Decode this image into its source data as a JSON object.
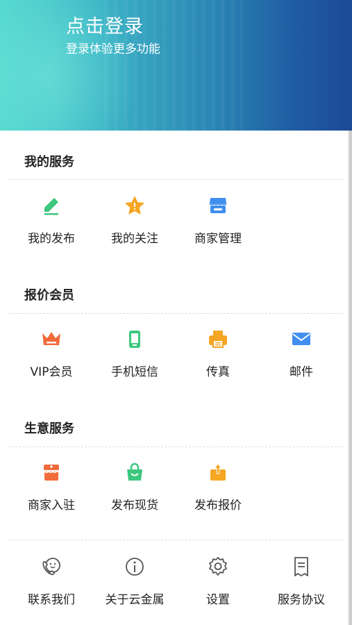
{
  "header": {
    "login_title": "点击登录",
    "login_subtitle": "登录体验更多功能",
    "gradient_start": "#54d8cf",
    "gradient_end": "#1c4a96"
  },
  "sections": {
    "my_services": {
      "title": "我的服务",
      "items": [
        {
          "label": "我的发布",
          "icon": "pencil-icon",
          "color": "#3dc77e"
        },
        {
          "label": "我的关注",
          "icon": "star-icon",
          "color": "#f5a623"
        },
        {
          "label": "商家管理",
          "icon": "store-icon",
          "color": "#3f8ef0"
        }
      ]
    },
    "quote_members": {
      "title": "报价会员",
      "items": [
        {
          "label": "VIP会员",
          "icon": "crown-icon",
          "color": "#f26b3a"
        },
        {
          "label": "手机短信",
          "icon": "phone-icon",
          "color": "#3dc77e"
        },
        {
          "label": "传真",
          "icon": "fax-icon",
          "color": "#f5a623"
        },
        {
          "label": "邮件",
          "icon": "mail-icon",
          "color": "#3f8ef0"
        }
      ]
    },
    "business_services": {
      "title": "生意服务",
      "items": [
        {
          "label": "商家入驻",
          "icon": "shop-entry-icon",
          "color": "#f26b3a"
        },
        {
          "label": "发布现货",
          "icon": "bag-icon",
          "color": "#3dc77e"
        },
        {
          "label": "发布报价",
          "icon": "upload-box-icon",
          "color": "#f5a623"
        }
      ]
    },
    "other": {
      "items": [
        {
          "label": "联系我们",
          "icon": "support-phone-icon",
          "color": "#555555"
        },
        {
          "label": "关于云金属",
          "icon": "info-icon",
          "color": "#555555"
        },
        {
          "label": "设置",
          "icon": "gear-icon",
          "color": "#555555"
        },
        {
          "label": "服务协议",
          "icon": "document-icon",
          "color": "#555555"
        }
      ]
    }
  }
}
